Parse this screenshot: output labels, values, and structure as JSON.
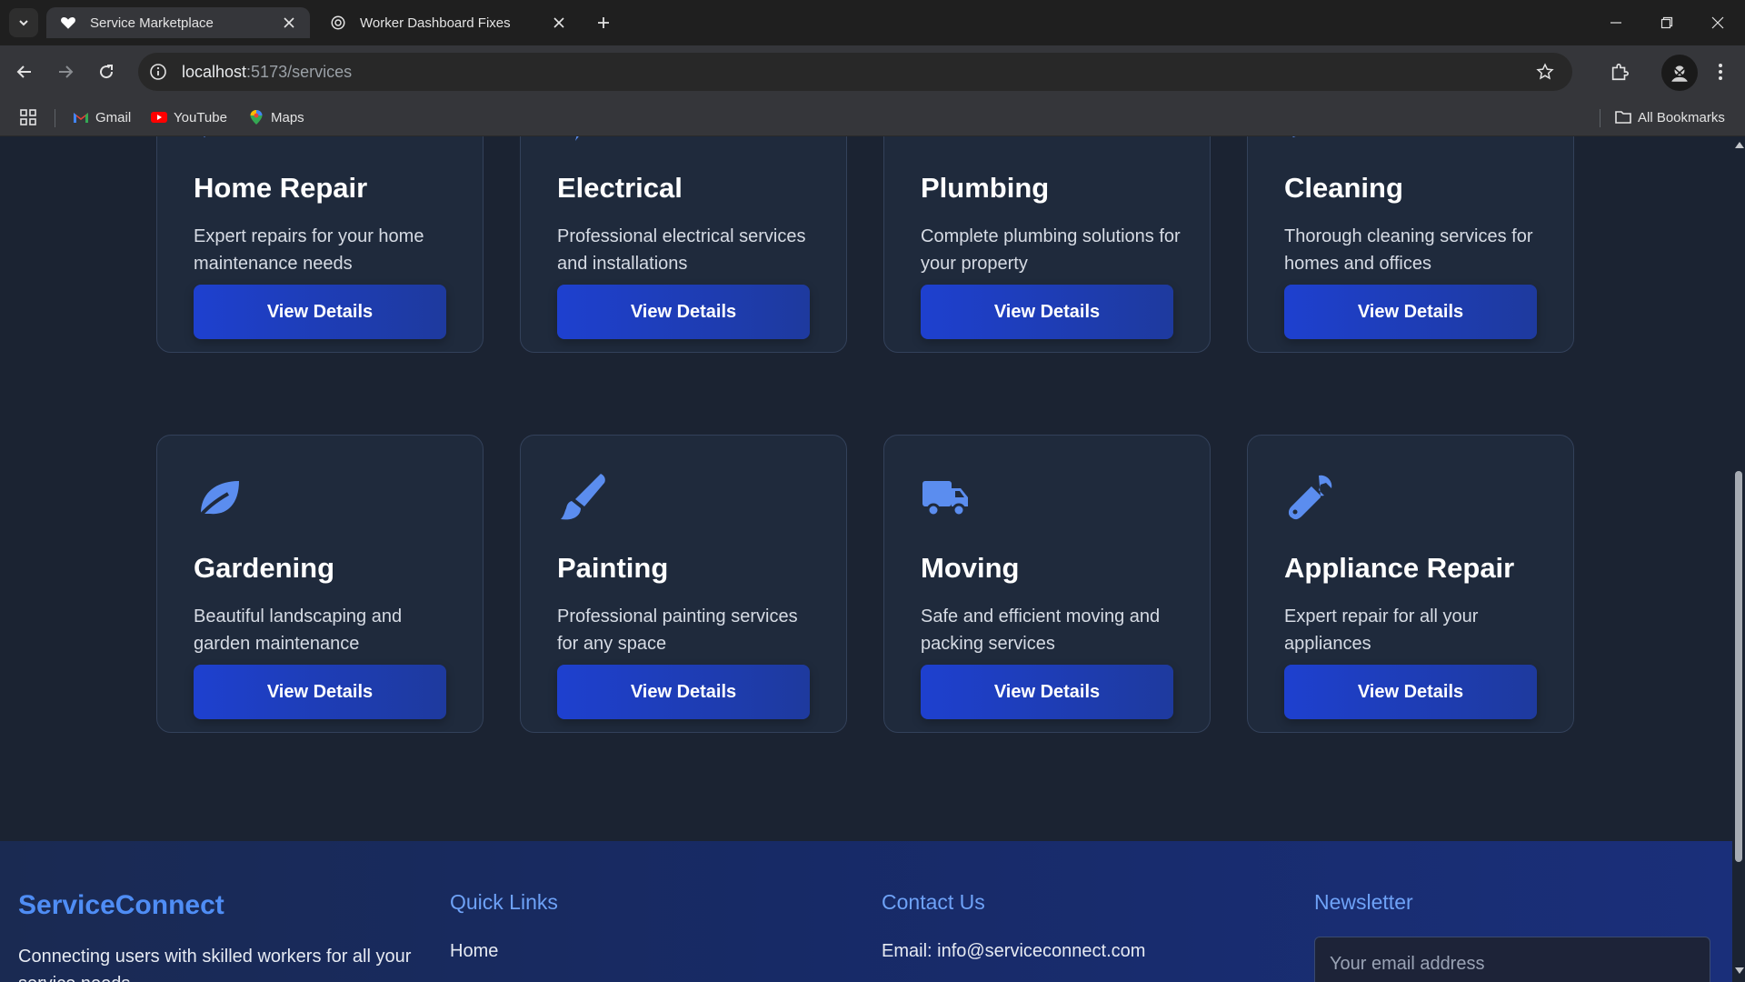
{
  "browser": {
    "tabs": [
      {
        "title": "Service Marketplace",
        "active": true,
        "favicon": "heart-icon"
      },
      {
        "title": "Worker Dashboard Fixes",
        "active": false,
        "favicon": "openai-icon"
      }
    ],
    "url": {
      "host": "localhost",
      "path": ":5173/services"
    },
    "bookmarks": [
      {
        "label": "Gmail",
        "icon": "gmail-icon"
      },
      {
        "label": "YouTube",
        "icon": "youtube-icon"
      },
      {
        "label": "Maps",
        "icon": "maps-icon"
      }
    ],
    "all_bookmarks_label": "All Bookmarks"
  },
  "services": [
    {
      "title": "Home Repair",
      "description": "Expert repairs for your home maintenance needs",
      "button": "View Details",
      "icon": "tools-icon"
    },
    {
      "title": "Electrical",
      "description": "Professional electrical services and installations",
      "button": "View Details",
      "icon": "bolt-icon"
    },
    {
      "title": "Plumbing",
      "description": "Complete plumbing solutions for your property",
      "button": "View Details",
      "icon": "faucet-icon"
    },
    {
      "title": "Cleaning",
      "description": "Thorough cleaning services for homes and offices",
      "button": "View Details",
      "icon": "broom-icon"
    },
    {
      "title": "Gardening",
      "description": "Beautiful landscaping and garden maintenance",
      "button": "View Details",
      "icon": "leaf-icon"
    },
    {
      "title": "Painting",
      "description": "Professional painting services for any space",
      "button": "View Details",
      "icon": "paintbrush-icon"
    },
    {
      "title": "Moving",
      "description": "Safe and efficient moving and packing services",
      "button": "View Details",
      "icon": "truck-icon"
    },
    {
      "title": "Appliance Repair",
      "description": "Expert repair for all your appliances",
      "button": "View Details",
      "icon": "wrench-icon"
    }
  ],
  "footer": {
    "brand": "ServiceConnect",
    "description": "Connecting users with skilled workers for all your service needs",
    "quick_links_title": "Quick Links",
    "quick_links": [
      "Home"
    ],
    "contact_title": "Contact Us",
    "contact_email": "Email: info@serviceconnect.com",
    "newsletter_title": "Newsletter",
    "newsletter_placeholder": "Your email address"
  },
  "colors": {
    "accent": "#4f8df5",
    "button": "#1e40cf",
    "card": "#1f2a3c",
    "page": "#1b2332"
  }
}
